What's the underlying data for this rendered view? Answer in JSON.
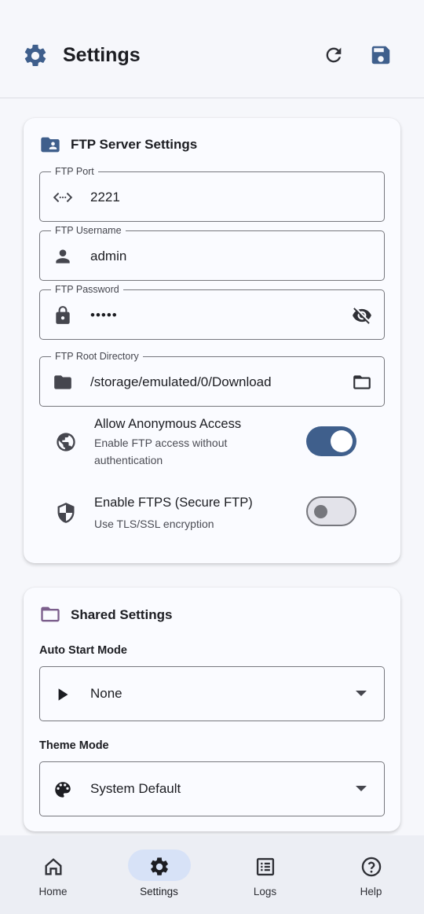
{
  "appbar": {
    "title": "Settings",
    "icons": [
      "gear-icon",
      "refresh-icon",
      "save-icon"
    ]
  },
  "colors": {
    "accent": "#3f5f8c",
    "nav_active_pill": "#d7e2f7",
    "card_bg": "#fafbff",
    "page_bg": "#f6f7fb"
  },
  "ftp": {
    "title": "FTP Server Settings",
    "port": {
      "label": "FTP Port",
      "value": "2221",
      "icon": "code-arrows-icon"
    },
    "username": {
      "label": "FTP Username",
      "value": "admin",
      "icon": "person-icon"
    },
    "password": {
      "label": "FTP Password",
      "value": "•••••",
      "icon": "lock-icon",
      "toggle_icon": "eye-off-icon"
    },
    "root": {
      "label": "FTP Root Directory",
      "value": "/storage/emulated/0/Download",
      "icon": "folder-icon",
      "browse_icon": "folder-open-icon"
    },
    "anonymous": {
      "title": "Allow Anonymous Access",
      "subtitle": "Enable FTP access without authentication",
      "enabled": true,
      "icon": "globe-icon"
    },
    "ftps": {
      "title": "Enable FTPS (Secure FTP)",
      "subtitle": "Use TLS/SSL encryption",
      "enabled": false,
      "icon": "shield-icon"
    }
  },
  "shared": {
    "title": "Shared Settings",
    "auto_start": {
      "label": "Auto Start Mode",
      "value": "None",
      "icon": "play-icon"
    },
    "theme": {
      "label": "Theme Mode",
      "value": "System Default",
      "icon": "palette-icon"
    }
  },
  "nav": {
    "items": [
      {
        "label": "Home",
        "icon": "home-icon",
        "active": false
      },
      {
        "label": "Settings",
        "icon": "settings-icon",
        "active": true
      },
      {
        "label": "Logs",
        "icon": "list-icon",
        "active": false
      },
      {
        "label": "Help",
        "icon": "help-icon",
        "active": false
      }
    ]
  }
}
